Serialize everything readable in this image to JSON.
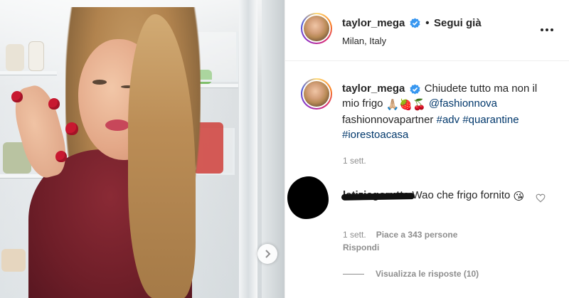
{
  "post": {
    "photo_alt": "",
    "next_icon": "chevron-right-icon"
  },
  "header": {
    "username": "taylor_mega",
    "verified_icon": "verified-badge-icon",
    "separator": "•",
    "follow_label": "Segui già",
    "location": "Milan, Italy",
    "more_icon": "more-options-icon"
  },
  "caption": {
    "username": "taylor_mega",
    "text": "Chiudete tutto ma non il mio frigo",
    "emojis": "🙏🏼🍓🍒",
    "mention": "@fashionnova",
    "mention_rest": "fashionnovapartner",
    "hashtags": [
      "#adv",
      "#quarantine",
      "#iorestoacasa"
    ],
    "time": "1 sett."
  },
  "comment": {
    "username": "letiziagorutta",
    "text": "Wao che frigo fornito",
    "emoji": "😘",
    "time": "1 sett.",
    "likes": "Piace a 343 persone",
    "reply_label": "Rispondi",
    "view_replies": "Visualizza le risposte (10)",
    "heart_icon": "heart-outline-icon"
  },
  "colors": {
    "text": "#262626",
    "secondary": "#8e8e8e",
    "link": "#00376b",
    "verified": "#3897f0"
  }
}
